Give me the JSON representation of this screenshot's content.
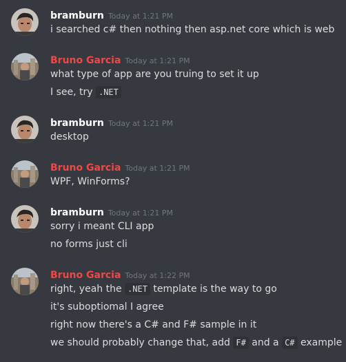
{
  "messages": [
    {
      "user": "bramburn",
      "user_color": "#ffffff",
      "time": "Today at 1:21 PM",
      "lines": [
        "i searched c# then nothing then asp.net core which is web"
      ]
    },
    {
      "user": "Bruno Garcia",
      "user_color": "#f04747",
      "time": "Today at 1:21 PM",
      "lines": [
        "what type of app are you truing to set it up"
      ],
      "line2_text": "I see, try ",
      "line2_code": ".NET"
    },
    {
      "user": "bramburn",
      "user_color": "#ffffff",
      "time": "Today at 1:21 PM",
      "lines": [
        "desktop"
      ]
    },
    {
      "user": "Bruno Garcia",
      "user_color": "#f04747",
      "time": "Today at 1:21 PM",
      "lines": [
        "WPF, WinForms?"
      ]
    },
    {
      "user": "bramburn",
      "user_color": "#ffffff",
      "time": "Today at 1:21 PM",
      "lines": [
        "sorry i meant CLI app",
        "no forms just cli"
      ]
    },
    {
      "user": "Bruno Garcia",
      "user_color": "#f04747",
      "time": "Today at 1:22 PM",
      "line1_a": "right, yeah the ",
      "line1_code": ".NET",
      "line1_b": " template is the way to go",
      "lines": [
        "it's suboptiomal I agree",
        "right now there's a C# and F# sample in it"
      ],
      "line4_a": "we should probably change that, add ",
      "line4_code1": "F#",
      "line4_b": " and a ",
      "line4_code2": "C#",
      "line4_c": " example"
    }
  ]
}
